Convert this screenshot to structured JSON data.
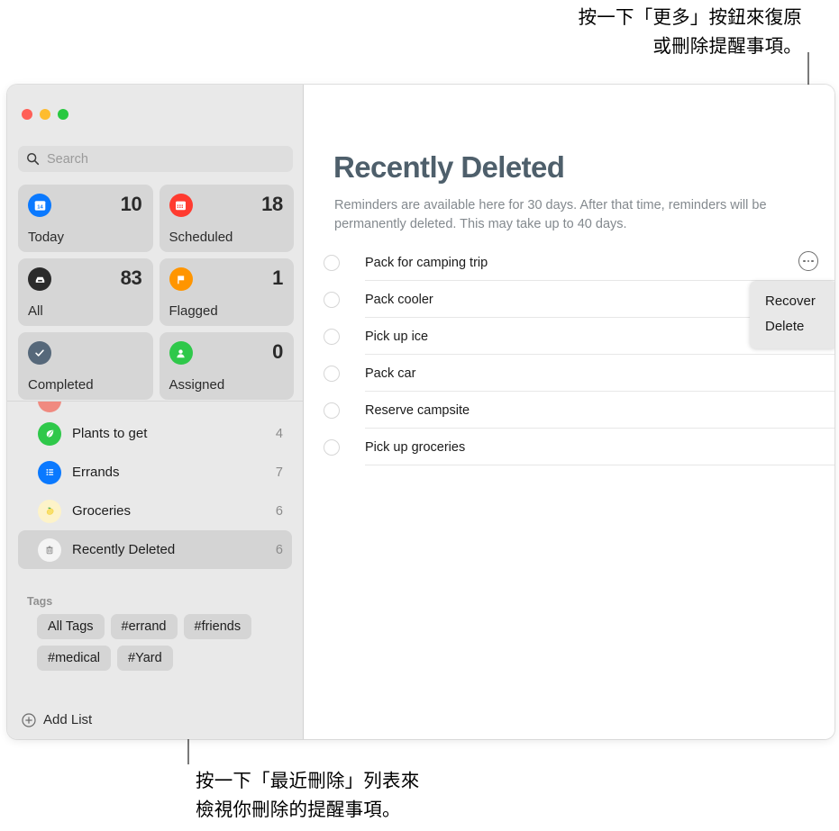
{
  "callouts": {
    "top": "按一下「更多」按鈕來復原\n或刪除提醒事項。",
    "bottom": "按一下「最近刪除」列表來\n檢視你刪除的提醒事項。"
  },
  "window": {
    "traffic_lights": {
      "close_color": "#ff5f57",
      "minimize_color": "#febc2e",
      "zoom_color": "#28c840"
    }
  },
  "sidebar": {
    "search": {
      "placeholder": "Search",
      "value": ""
    },
    "smart_lists": [
      {
        "label": "Today",
        "count": "10",
        "icon": "calendar-day-icon",
        "color": "#0a79ff"
      },
      {
        "label": "Scheduled",
        "count": "18",
        "icon": "calendar-icon",
        "color": "#ff3b30"
      },
      {
        "label": "All",
        "count": "83",
        "icon": "inbox-tray-icon",
        "color": "#2b2b2b"
      },
      {
        "label": "Flagged",
        "count": "1",
        "icon": "flag-icon",
        "color": "#ff9500"
      },
      {
        "label": "Completed",
        "count": "",
        "icon": "checkmark-icon",
        "color": "#56687a"
      },
      {
        "label": "Assigned",
        "count": "0",
        "icon": "person-icon",
        "color": "#2fc84a"
      }
    ],
    "lists": [
      {
        "label": "Plants to get",
        "count": "4",
        "icon": "leaf-icon",
        "color": "#2fc84a",
        "selected": false
      },
      {
        "label": "Errands",
        "count": "7",
        "icon": "list-icon",
        "color": "#0a79ff",
        "selected": false
      },
      {
        "label": "Groceries",
        "count": "6",
        "icon": "lemon-icon",
        "color": "#fdf3c9",
        "selected": false
      },
      {
        "label": "Recently Deleted",
        "count": "6",
        "icon": "trash-icon",
        "color": "#f3f3f3",
        "selected": true
      }
    ],
    "tags": {
      "title": "Tags",
      "chips": [
        "All Tags",
        "#errand",
        "#friends",
        "#medical",
        "#Yard"
      ]
    },
    "add_list_label": "Add List"
  },
  "main": {
    "title": "Recently Deleted",
    "description": "Reminders are available here for 30 days. After that time, reminders will be permanently deleted. This may take up to 40 days.",
    "reminders": [
      {
        "title": "Pack for camping trip"
      },
      {
        "title": "Pack cooler"
      },
      {
        "title": "Pick up ice"
      },
      {
        "title": "Pack car"
      },
      {
        "title": "Reserve campsite"
      },
      {
        "title": "Pick up groceries"
      }
    ],
    "popup_menu": {
      "items": [
        "Recover",
        "Delete"
      ]
    }
  }
}
